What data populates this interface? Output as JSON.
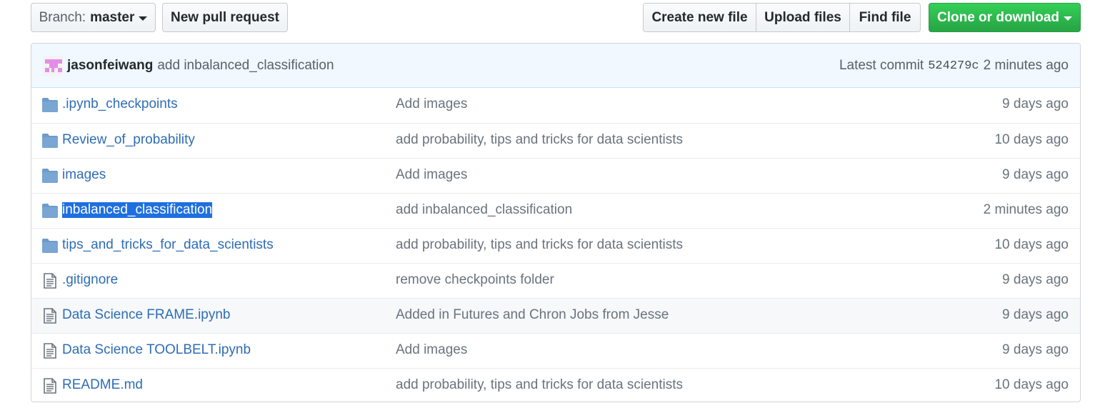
{
  "toolbar": {
    "branch_prefix": "Branch:",
    "branch_name": "master",
    "new_pull_request": "New pull request",
    "create_new_file": "Create new file",
    "upload_files": "Upload files",
    "find_file": "Find file",
    "clone_or_download": "Clone or download"
  },
  "commit": {
    "author": "jasonfeiwang",
    "message": "add inbalanced_classification",
    "latest_label": "Latest commit",
    "sha": "524279c",
    "time": "2 minutes ago"
  },
  "files": [
    {
      "type": "folder",
      "icon": "folder-icon",
      "name": ".ipynb_checkpoints",
      "message": "Add images",
      "age": "9 days ago"
    },
    {
      "type": "folder",
      "icon": "folder-icon",
      "name": "Review_of_probability",
      "message": "add probability, tips and tricks for data scientists",
      "age": "10 days ago"
    },
    {
      "type": "folder",
      "icon": "folder-icon",
      "name": "images",
      "message": "Add images",
      "age": "9 days ago"
    },
    {
      "type": "folder",
      "icon": "folder-icon",
      "name": "inbalanced_classification",
      "message": "add inbalanced_classification",
      "age": "2 minutes ago",
      "selected": true
    },
    {
      "type": "folder",
      "icon": "folder-icon",
      "name": "tips_and_tricks_for_data_scientists",
      "message": "add probability, tips and tricks for data scientists",
      "age": "10 days ago"
    },
    {
      "type": "file",
      "icon": "file-icon",
      "name": ".gitignore",
      "message": "remove checkpoints folder",
      "age": "9 days ago"
    },
    {
      "type": "file",
      "icon": "file-icon",
      "name": "Data Science FRAME.ipynb",
      "message": "Added in Futures and Chron Jobs from Jesse",
      "age": "9 days ago",
      "hover": true
    },
    {
      "type": "file",
      "icon": "file-icon",
      "name": "Data Science TOOLBELT.ipynb",
      "message": "Add images",
      "age": "9 days ago"
    },
    {
      "type": "file",
      "icon": "file-icon",
      "name": "README.md",
      "message": "add probability, tips and tricks for data scientists",
      "age": "10 days ago"
    }
  ],
  "colors": {
    "link": "#2e6db4",
    "clone_button": "#28a745",
    "commit_bar_bg": "#f1f8ff",
    "folder_icon": "#79b8ff",
    "selection": "#1e6fe0"
  }
}
